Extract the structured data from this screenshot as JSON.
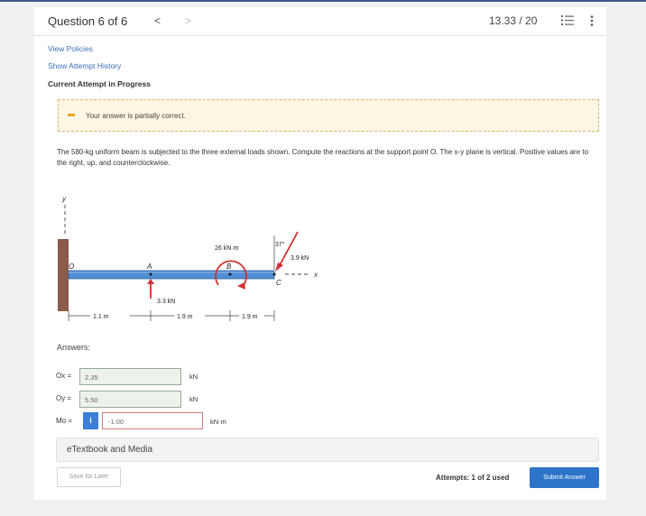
{
  "header": {
    "question_label": "Question 6 of 6",
    "prev_glyph": "<",
    "next_glyph": ">",
    "score": "13.33 / 20"
  },
  "links": {
    "view_policies": "View Policies",
    "show_attempt_history": "Show Attempt History",
    "current_attempt": "Current Attempt in Progress"
  },
  "notice": {
    "text": "Your answer is partially correct.",
    "color": "#e9a21c"
  },
  "problem": {
    "text": "The 580-kg uniform beam is subjected to the three external loads shown. Compute the reactions at the support point O. The x-y plane is vertical. Positive values are to the right, up, and counterclockwise."
  },
  "figure": {
    "y_axis": "y",
    "x_axis": "x",
    "point_o": "O",
    "point_a": "A",
    "point_b": "B",
    "point_c": "C",
    "force_a": "3.3 kN",
    "moment": "26 kN·m",
    "angle": "37°",
    "force_c": "3.9 kN",
    "dim_1": "1.1 m",
    "dim_2": "1.9 m",
    "dim_3": "1.9 m"
  },
  "answers": {
    "label": "Answers:",
    "ox": {
      "label": "Ox =",
      "value": "2.35",
      "unit": "kN"
    },
    "oy": {
      "label": "Oy =",
      "value": "5.50",
      "unit": "kN"
    },
    "mo": {
      "label": "Mo =",
      "badge": "i",
      "value": "-1.00",
      "unit": "kN·m"
    }
  },
  "etextbook": "eTextbook and Media",
  "footer": {
    "save_label": "Save for Later",
    "attempts": "Attempts: 1 of 2 used",
    "submit_label": "Submit Answer"
  }
}
